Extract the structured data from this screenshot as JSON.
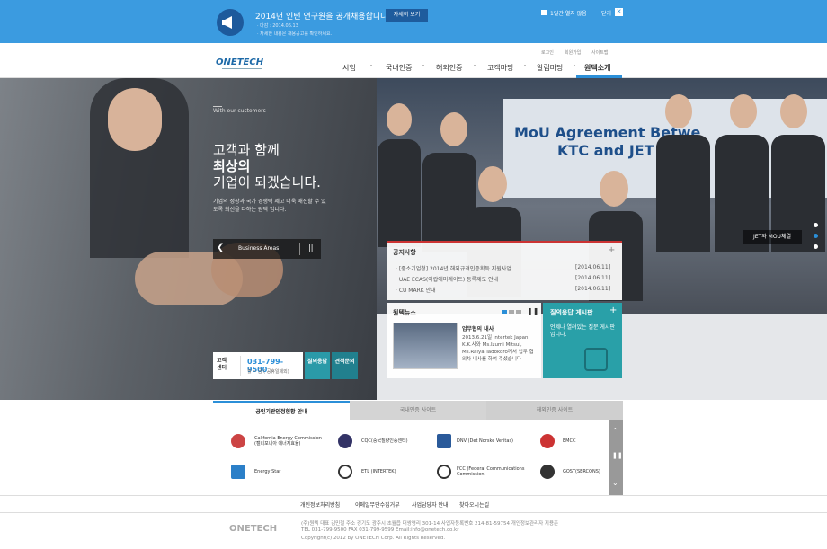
{
  "popup": {
    "title": "2014년 인턴 연구원을 공개채용합니다.",
    "deadline": "· 마감 : 2014.06.13",
    "note": "· 자세한 내용은 채용공고를 확인하세요.",
    "detail_btn": "자세히 보기",
    "one_day": "1일간 열지 않음",
    "close": "닫기",
    "close_icon": "✕"
  },
  "header": {
    "logo": "ONETECH",
    "util": [
      "로그인",
      "회원가입",
      "사이트맵"
    ],
    "nav": [
      "시험",
      "국내인증",
      "해외인증",
      "고객마당",
      "알림마당",
      "원텍소개"
    ]
  },
  "hero": {
    "tagline": "With our customers",
    "h1": "고객과 함께",
    "h2": "최상의",
    "h3": "기업이 되겠습니다.",
    "sub": "기업의 성장과 국가 경쟁력 제고 더욱 매진할 수 있도록 최선을 다하는 원텍 입니다.",
    "business": "Business Areas",
    "arrow": "❮",
    "ctl": "||",
    "cs_label": "고객센터",
    "cs_tel": "031-799-9500",
    "cs_hours": "월 ~ 금 ( 공휴일제외)",
    "qa": "질의응답",
    "quote": "견적문의",
    "banner1": "MoU Agreement Betwe",
    "banner2": "KTC and JET",
    "jet": "JET와 MOU체결"
  },
  "notice": {
    "title": "공지사항",
    "plus": "+",
    "items": [
      {
        "t": "· [중소기업청] 2014년 해외규격인증획득 지원사업",
        "d": "[2014.06.11]"
      },
      {
        "t": "· UAE ECAS(아랍에미레이트) 등록제도 안내",
        "d": "[2014.06.11]"
      },
      {
        "t": "· CU MARK 안내",
        "d": "[2014.06.11]"
      }
    ]
  },
  "news": {
    "title": "원텍뉴스",
    "play": "❚❚",
    "ntitle": "업무협의 내사",
    "nbody": "2013.6.21일 Intertek Japan K.K.사와 Ms.Izumi Mitsui, Ms.Raiya Tadokoro께서 업무 협의차 내사를 하여 주셨습니다"
  },
  "faq": {
    "title": "질의응답 게시판",
    "plus": "+",
    "text": "언제나 열려있는 질문 게시판입니다."
  },
  "tabs": [
    "공인기관인정현황 안내",
    "국내인증 사이트",
    "해외인증 사이트"
  ],
  "certs": [
    {
      "n": "California Energy Commission (캘리포니아 에너지효율)",
      "c": "#c44"
    },
    {
      "n": "CQC(중국질량인증센터)",
      "c": "#336"
    },
    {
      "n": "DNV (Det Norske Veritas)",
      "c": "#2a5a9a"
    },
    {
      "n": "EMCC",
      "c": "#c33"
    },
    {
      "n": "Energy Star",
      "c": "#2b7fc8"
    },
    {
      "n": "ETL (INTERTEK)",
      "c": "#333"
    },
    {
      "n": "FCC (Federal Communications Commission)",
      "c": "#333"
    },
    {
      "n": "GOST(SERCONS)",
      "c": "#333"
    }
  ],
  "scroll": {
    "up": "⌃",
    "mid": "❚❚",
    "down": "⌄"
  },
  "footer": {
    "links": [
      "개인정보처리방침",
      "이메일무단수집거부",
      "사업담당자 안내",
      "찾아오시는길"
    ],
    "logo": "ONETECH",
    "addr": "(주)원텍 대표 김민철 주소 경기도 광주시 초월읍 대쌍령리 301-14 사업자등록번호 214-81-59754 개인정보관리자 지용준",
    "tel": "TEL 031-799-9500 FAX 031-799-9599 Email:info@onetech.co.kr",
    "copy": "Copyright(c) 2012 by ONETECH Corp. All Rights Reserved."
  }
}
